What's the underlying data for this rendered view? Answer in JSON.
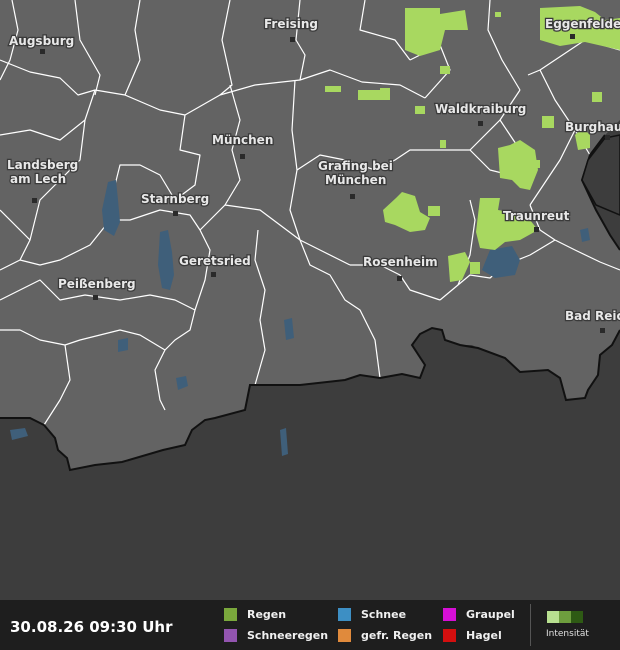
{
  "map": {
    "cities": [
      {
        "name": "Augsburg"
      },
      {
        "name": "Freising"
      },
      {
        "name": "Eggenfelden"
      },
      {
        "name": "Waldkraiburg"
      },
      {
        "name": "Burghausen"
      },
      {
        "name": "München"
      },
      {
        "name": "Landsberg"
      },
      {
        "name": "am Lech"
      },
      {
        "name": "Grafing bei"
      },
      {
        "name": "München"
      },
      {
        "name": "Starnberg"
      },
      {
        "name": "Traunreut"
      },
      {
        "name": "Geretsried"
      },
      {
        "name": "Rosenheim"
      },
      {
        "name": "Peißenberg"
      },
      {
        "name": "Bad Reichenhall"
      }
    ],
    "colors": {
      "bavaria_land": "#636363",
      "outside_area": "#3d3d3d",
      "boundaries": "#ffffff",
      "water": "#3f5f7a",
      "rain_light": "#a8d860"
    }
  },
  "legend": {
    "timestamp": "30.08.26 09:30 Uhr",
    "items": [
      {
        "label": "Regen",
        "color": "#7aa83c"
      },
      {
        "label": "Schneeregen",
        "color": "#9355b0"
      },
      {
        "label": "Schnee",
        "color": "#3d8fc4"
      },
      {
        "label": "gefr. Regen",
        "color": "#e08a3c"
      },
      {
        "label": "Graupel",
        "color": "#d60fd6"
      },
      {
        "label": "Hagel",
        "color": "#d40f0f"
      }
    ],
    "intensity": {
      "label": "Intensität",
      "colors": [
        "#b8e090",
        "#6e9e3e",
        "#2e5a14"
      ]
    }
  }
}
